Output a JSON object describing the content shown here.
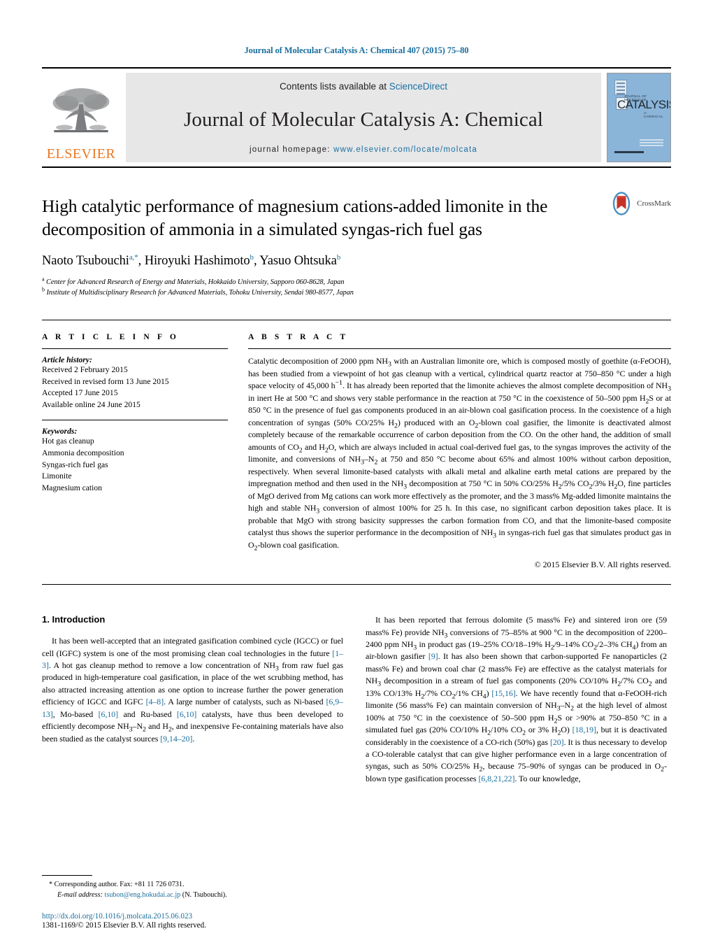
{
  "running_head": "Journal of Molecular Catalysis A: Chemical 407 (2015) 75–80",
  "masthead": {
    "contents_prefix": "Contents lists available at ",
    "contents_link": "ScienceDirect",
    "journal_title": "Journal of Molecular Catalysis A: Chemical",
    "homepage_prefix": "journal homepage: ",
    "homepage_url": "www.elsevier.com/locate/molcata",
    "publisher_name": "ELSEVIER",
    "publisher_logo_icon": "elsevier-tree-icon",
    "cover_title_small": "JOURNAL OF MOLECULAR",
    "cover_title_big": "CATALYSIS",
    "cover_title_sub": "A: CHEMICAL",
    "accent_color": "#1a6f9e",
    "elsevier_orange": "#E87722",
    "cover_blue": "#8ab4d8"
  },
  "article": {
    "title": "High catalytic performance of magnesium cations-added limonite in the decomposition of ammonia in a simulated syngas-rich fuel gas",
    "crossmark_label": "CrossMark",
    "crossmark_icon": "crossmark-icon",
    "authors_html": "Naoto Tsubouchi<sup>a,*</sup>, Hiroyuki Hashimoto<sup>b</sup>, Yasuo Ohtsuka<sup>b</sup>",
    "affiliations": [
      {
        "marker": "a",
        "text": "Center for Advanced Research of Energy and Materials, Hokkaido University, Sapporo 060-8628, Japan"
      },
      {
        "marker": "b",
        "text": "Institute of Multidisciplinary Research for Advanced Materials, Tohoku University, Sendai 980-8577, Japan"
      }
    ]
  },
  "article_info": {
    "heading": "A R T I C L E   I N F O",
    "history_label": "Article history:",
    "history": [
      "Received 2 February 2015",
      "Received in revised form 13 June 2015",
      "Accepted 17 June 2015",
      "Available online 24 June 2015"
    ],
    "keywords_label": "Keywords:",
    "keywords": [
      "Hot gas cleanup",
      "Ammonia decomposition",
      "Syngas-rich fuel gas",
      "Limonite",
      "Magnesium cation"
    ]
  },
  "abstract": {
    "heading": "A B S T R A C T",
    "body_html": "Catalytic decomposition of 2000 ppm NH<sub>3</sub> with an Australian limonite ore, which is composed mostly of goethite (&alpha;-FeOOH), has been studied from a viewpoint of hot gas cleanup with a vertical, cylindrical quartz reactor at 750&ndash;850 &deg;C under a high space velocity of 45,000 h<sup>&minus;1</sup>. It has already been reported that the limonite achieves the almost complete decomposition of NH<sub>3</sub> in inert He at 500 &deg;C and shows very stable performance in the reaction at 750 &deg;C in the coexistence of 50&ndash;500 ppm H<sub>2</sub>S or at 850 &deg;C in the presence of fuel gas components produced in an air-blown coal gasification process. In the coexistence of a high concentration of syngas (50% CO/25% H<sub>2</sub>) produced with an O<sub>2</sub>-blown coal gasifier, the limonite is deactivated almost completely because of the remarkable occurrence of carbon deposition from the CO. On the other hand, the addition of small amounts of CO<sub>2</sub> and H<sub>2</sub>O, which are always included in actual coal-derived fuel gas, to the syngas improves the activity of the limonite, and conversions of NH<sub>3</sub>&ndash;N<sub>2</sub> at 750 and 850 &deg;C become about 65% and almost 100% without carbon deposition, respectively. When several limonite-based catalysts with alkali metal and alkaline earth metal cations are prepared by the impregnation method and then used in the NH<sub>3</sub> decomposition at 750 &deg;C in 50% CO/25% H<sub>2</sub>/5% CO<sub>2</sub>/3% H<sub>2</sub>O, fine particles of MgO derived from Mg cations can work more effectively as the promoter, and the 3 mass% Mg-added limonite maintains the high and stable NH<sub>3</sub> conversion of almost 100% for 25 h. In this case, no significant carbon deposition takes place. It is probable that MgO with strong basicity suppresses the carbon formation from CO, and that the limonite-based composite catalyst thus shows the superior performance in the decomposition of NH<sub>3</sub> in syngas-rich fuel gas that simulates product gas in O<sub>2</sub>-blown coal gasification.",
    "copyright": "© 2015 Elsevier B.V. All rights reserved."
  },
  "section": {
    "number_and_title": "1.  Introduction",
    "left_paragraph_html": "It has been well-accepted that an integrated gasification combined cycle (IGCC) or fuel cell (IGFC) system is one of the most promising clean coal technologies in the future <span class=\"ref\">[1&ndash;3]</span>. A hot gas cleanup method to remove a low concentration of NH<sub>3</sub> from raw fuel gas produced in high-temperature coal gasification, in place of the wet scrubbing method, has also attracted increasing attention as one option to increase further the power generation efficiency of IGCC and IGFC <span class=\"ref\">[4&ndash;8]</span>. A large number of catalysts, such as Ni-based <span class=\"ref\">[6,9&ndash;13]</span>, Mo-based <span class=\"ref\">[6,10]</span> and Ru-based <span class=\"ref\">[6,10]</span> catalysts, have thus been developed to efficiently decompose NH<sub>3</sub>&ndash;N<sub>2</sub> and H<sub>2</sub>, and inexpensive Fe-containing materials have also been studied as the catalyst sources <span class=\"ref\">[9,14&ndash;20]</span>.",
    "right_paragraph_html": "It has been reported that ferrous dolomite (5 mass% Fe) and sintered iron ore (59 mass% Fe) provide NH<sub>3</sub> conversions of 75&ndash;85% at 900 &deg;C in the decomposition of 2200&ndash;2400 ppm NH<sub>3</sub> in product gas (19&ndash;25% CO/18&ndash;19% H<sub>2</sub>/9&ndash;14% CO<sub>2</sub>/2&ndash;3% CH<sub>4</sub>) from an air-blown gasifier <span class=\"ref\">[9]</span>. It has also been shown that carbon-supported Fe nanoparticles (2 mass% Fe) and brown coal char (2 mass% Fe) are effective as the catalyst materials for NH<sub>3</sub> decomposition in a stream of fuel gas components (20% CO/10% H<sub>2</sub>/7% CO<sub>2</sub> and 13% CO/13% H<sub>2</sub>/7% CO<sub>2</sub>/1% CH<sub>4</sub>) <span class=\"ref\">[15,16]</span>. We have recently found that &alpha;-FeOOH-rich limonite (56 mass% Fe) can maintain conversion of NH<sub>3</sub>&ndash;N<sub>2</sub> at the high level of almost 100% at 750 &deg;C in the coexistence of 50&ndash;500 ppm H<sub>2</sub>S or &gt;90% at 750&ndash;850 &deg;C in a simulated fuel gas (20% CO/10% H<sub>2</sub>/10% CO<sub>2</sub> or 3% H<sub>2</sub>O) <span class=\"ref\">[18,19]</span>, but it is deactivated considerably in the coexistence of a CO-rich (50%) gas <span class=\"ref\">[20]</span>. It is thus necessary to develop a CO-tolerable catalyst that can give higher performance even in a large concentration of syngas, such as 50% CO/25% H<sub>2</sub>, because 75&ndash;90% of syngas can be produced in O<sub>2</sub>-blown type gasification processes <span class=\"ref\">[6,8,21,22]</span>. To our knowledge,"
  },
  "footnote": {
    "corresponding_html": "* Corresponding author. Fax: +81 11 726 0731.",
    "email_label": "E-mail address:",
    "email": "tsubon@eng.hokudai.ac.jp",
    "email_suffix": "(N. Tsubouchi).",
    "doi": "http://dx.doi.org/10.1016/j.molcata.2015.06.023",
    "issn_line": "1381-1169/© 2015 Elsevier B.V. All rights reserved."
  }
}
